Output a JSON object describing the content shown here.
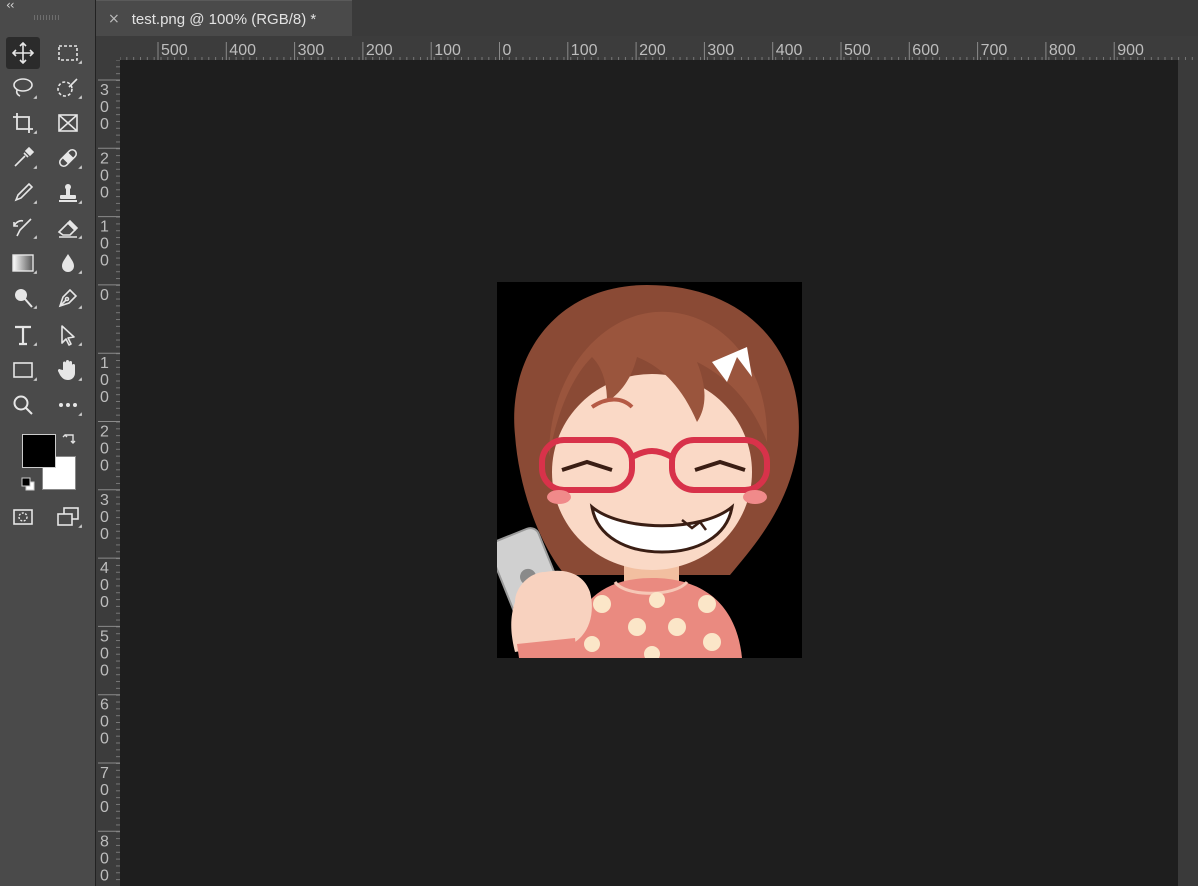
{
  "toolbar": {
    "collapse_label": "‹‹",
    "tools": [
      {
        "name": "move-tool",
        "icon": "move-icon"
      },
      {
        "name": "marquee-tool",
        "icon": "rectangular-marquee-icon"
      },
      {
        "name": "lasso-tool",
        "icon": "lasso-icon"
      },
      {
        "name": "quick-selection-tool",
        "icon": "quick-selection-icon"
      },
      {
        "name": "crop-tool",
        "icon": "crop-icon"
      },
      {
        "name": "frame-tool",
        "icon": "frame-icon"
      },
      {
        "name": "eyedropper-tool",
        "icon": "eyedropper-icon"
      },
      {
        "name": "healing-brush-tool",
        "icon": "bandage-icon"
      },
      {
        "name": "brush-tool",
        "icon": "brush-icon"
      },
      {
        "name": "clone-stamp-tool",
        "icon": "stamp-icon"
      },
      {
        "name": "history-brush-tool",
        "icon": "history-brush-icon"
      },
      {
        "name": "eraser-tool",
        "icon": "eraser-icon"
      },
      {
        "name": "gradient-tool",
        "icon": "gradient-icon"
      },
      {
        "name": "blur-tool",
        "icon": "droplet-icon"
      },
      {
        "name": "dodge-tool",
        "icon": "dodge-icon"
      },
      {
        "name": "pen-tool",
        "icon": "pen-icon"
      },
      {
        "name": "type-tool",
        "icon": "type-icon"
      },
      {
        "name": "path-selection-tool",
        "icon": "arrow-cursor-icon"
      },
      {
        "name": "rectangle-tool",
        "icon": "rectangle-icon"
      },
      {
        "name": "hand-tool",
        "icon": "hand-icon"
      },
      {
        "name": "zoom-tool",
        "icon": "magnifier-icon"
      },
      {
        "name": "more-tools",
        "icon": "ellipsis-icon"
      }
    ],
    "foreground_color": "#000000",
    "background_color": "#ffffff"
  },
  "tab": {
    "close": "×",
    "title": "test.png @ 100% (RGB/8) *"
  },
  "rulers": {
    "horizontal_labels": [
      "500",
      "400",
      "300",
      "200",
      "100",
      "0",
      "100",
      "200",
      "300",
      "400",
      "500",
      "600",
      "700",
      "800",
      "900"
    ],
    "vertical_labels": [
      "300",
      "200",
      "100",
      "0",
      "100",
      "200",
      "300",
      "400",
      "500",
      "600",
      "700",
      "800"
    ]
  },
  "document": {
    "file_name": "test.png",
    "zoom": "100%",
    "color_mode": "RGB/8",
    "background": "#000000"
  }
}
